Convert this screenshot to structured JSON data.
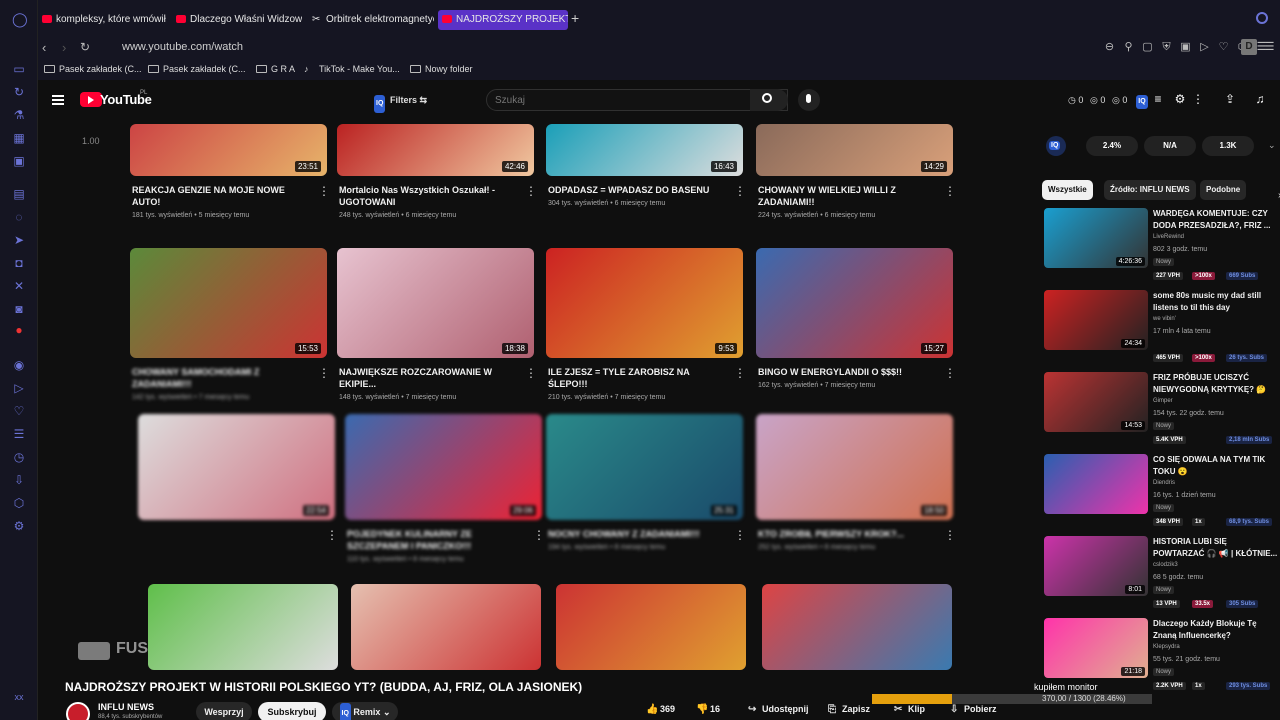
{
  "tabs": [
    {
      "label": "kompleksy, które wmówiły",
      "active": false
    },
    {
      "label": "Dlaczego Właśni Widzowie",
      "active": false
    },
    {
      "label": "Orbitrek elektromagnetyczny",
      "active": false
    },
    {
      "label": "NAJDROŻSZY PROJEKT",
      "active": true
    }
  ],
  "address": {
    "url": "www.youtube.com/watch"
  },
  "profile_initial": "D",
  "bookmarks": [
    "Pasek zakładek (C...",
    "Pasek zakładek (C...",
    "G R A",
    "TikTok - Make You...",
    "Nowy folder"
  ],
  "header": {
    "logo_text": "YouTube",
    "region": "PL",
    "filters_label": "Filters",
    "iq_label": "IQ",
    "search_placeholder": "Szukaj",
    "stats": [
      "0",
      "0",
      "0"
    ]
  },
  "player": {
    "speed": "1.00",
    "watermark": "FUSIALKA"
  },
  "grid": [
    {
      "title": "REAKCJA GENZIE NA MOJE NOWE AUTO!",
      "meta": "181 tys. wyświetleń • 5 miesięcy temu",
      "duration": "23:51",
      "blur": false
    },
    {
      "title": "Mortalcio Nas Wszystkich Oszukał! - UGOTOWANI",
      "meta": "248 tys. wyświetleń • 6 miesięcy temu",
      "duration": "42:46",
      "blur": false
    },
    {
      "title": "ODPADASZ = WPADASZ DO BASENU",
      "meta": "304 tys. wyświetleń • 6 miesięcy temu",
      "duration": "16:43",
      "blur": false
    },
    {
      "title": "CHOWANY W WIELKIEJ WILLI Z ZADANIAMI!!",
      "meta": "224 tys. wyświetleń • 6 miesięcy temu",
      "duration": "14:29",
      "blur": false
    },
    {
      "title": "CHOWANY SAMOCHODAMI Z ZADANIAMI!!!",
      "meta": "142 tys. wyświetleń • 7 miesięcy temu",
      "duration": "15:53",
      "blur": true
    },
    {
      "title": "NAJWIĘKSZE ROZCZAROWANIE W EKIPIE...",
      "meta": "148 tys. wyświetleń • 7 miesięcy temu",
      "duration": "18:38",
      "blur": false
    },
    {
      "title": "ILE ZJESZ = TYLE ZAROBISZ NA ŚLEPO!!!",
      "meta": "210 tys. wyświetleń • 7 miesięcy temu",
      "duration": "9:53",
      "blur": false
    },
    {
      "title": "BINGO W ENERGYLANDII O $$$!!",
      "meta": "162 tys. wyświetleń • 7 miesięcy temu",
      "duration": "15:27",
      "blur": false
    },
    {
      "title": "",
      "meta": "",
      "duration": "22:54",
      "blur": true
    },
    {
      "title": "POJEDYNEK KULINARNY ZE SZCZEPANEM I PANICZKO!!!",
      "meta": "110 tys. wyświetleń • 8 miesięcy temu",
      "duration": "29:06",
      "blur": true
    },
    {
      "title": "NOCNY CHOWANY Z ZADANIAMI!!!",
      "meta": "194 tys. wyświetleń • 8 miesięcy temu",
      "duration": "25:31",
      "blur": true
    },
    {
      "title": "KTO ZROBIŁ PIERWSZY KROK?...",
      "meta": "252 tys. wyświetleń • 8 miesięcy temu",
      "duration": "18:50",
      "blur": true
    }
  ],
  "right": {
    "stats": [
      "2.4%",
      "N/A",
      "1.3K"
    ],
    "chips": [
      "Wszystkie",
      "Źródło: INFLU NEWS",
      "Podobne"
    ],
    "items": [
      {
        "title": "WARDĘGA KOMENTUJE: CZY DODA PRZESADZIŁA?, FRIZ ...",
        "channel": "LiveRewind",
        "meta": "802  3 godz. temu",
        "tag": "Nowy",
        "duration": "4:26:36",
        "vph": "227 VPH",
        "mult": ">100x",
        "subs": "669 Subs"
      },
      {
        "title": "some 80s music my dad still listens to til this day",
        "channel": "we vibin'",
        "meta": "17 mln  4 lata temu",
        "tag": "",
        "duration": "24:34",
        "vph": "465 VPH",
        "mult": ">100x",
        "subs": "26 tys. Subs"
      },
      {
        "title": "FRIZ PRÓBUJE UCISZYĆ NIEWYGODNĄ KRYTYKĘ? 🤔",
        "channel": "Gimper",
        "meta": "154 tys.  22 godz. temu",
        "tag": "Nowy",
        "duration": "14:53",
        "vph": "5.4K VPH",
        "mult": "",
        "subs": "2,18 mln Subs"
      },
      {
        "title": "CO SIĘ ODWALA NA TYM TIK TOKU 😮",
        "channel": "Diendris",
        "meta": "16 tys.  1 dzień temu",
        "tag": "Nowy",
        "duration": "",
        "vph": "348 VPH",
        "mult": "1x",
        "subs": "68,9 tys. Subs"
      },
      {
        "title": "HISTORIA LUBI SIĘ POWTARZAĆ 🎧 📢 | KŁÓTNIE...",
        "channel": "cslodzik3",
        "meta": "68  5 godz. temu",
        "tag": "Nowy",
        "duration": "8:01",
        "vph": "13 VPH",
        "mult": "33.5x",
        "subs": "305 Subs"
      },
      {
        "title": "Dlaczego Każdy Blokuje Tę Znaną Influencerkę?",
        "channel": "Klepsydra",
        "meta": "55 tys.  21 godz. temu",
        "tag": "Nowy",
        "duration": "21:18",
        "vph": "2.2K VPH",
        "mult": "1x",
        "subs": "293 tys. Subs"
      }
    ]
  },
  "video": {
    "title": "NAJDROŻSZY PROJEKT W HISTORII POLSKIEGO YT? (BUDDA, AJ, FRIZ, OLA JASIONEK)",
    "channel": "INFLU NEWS",
    "subs": "88,4 tys. subskrybentów",
    "support": "Wesprzyj",
    "subscribe": "Subskrybuj",
    "remix": "Remix",
    "likes": "369",
    "dislikes": "16",
    "share": "Udostępnij",
    "save": "Zapisz",
    "clip": "Klip",
    "download": "Pobierz"
  },
  "monitor": {
    "label": "kupiłem monitor",
    "progress_text": "370,00 / 1300 (28.46%)",
    "progress": 0.2846
  },
  "colors": {
    "accent_purple": "#5a32c7",
    "yt_red": "#ff0033",
    "iq_blue": "#2d5fd4",
    "monitor_fill": "#e5a00d"
  }
}
